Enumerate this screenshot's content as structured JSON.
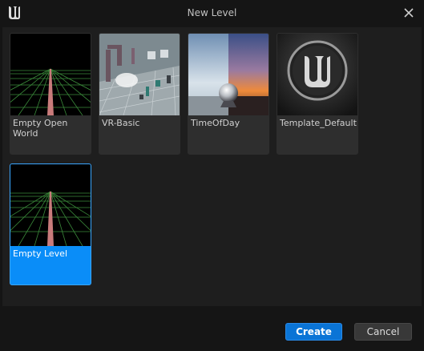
{
  "window": {
    "title": "New Level"
  },
  "templates": [
    {
      "label": "Empty Open World",
      "selected": false
    },
    {
      "label": "VR-Basic",
      "selected": false
    },
    {
      "label": "TimeOfDay",
      "selected": false
    },
    {
      "label": "Template_Default",
      "selected": false
    },
    {
      "label": "Empty Level",
      "selected": true
    }
  ],
  "footer": {
    "create_label": "Create",
    "cancel_label": "Cancel"
  },
  "colors": {
    "accent": "#0a8df8",
    "create_button": "#0a74d6"
  },
  "icons": {
    "app": "unreal-engine-logo-icon",
    "close": "close-icon"
  }
}
